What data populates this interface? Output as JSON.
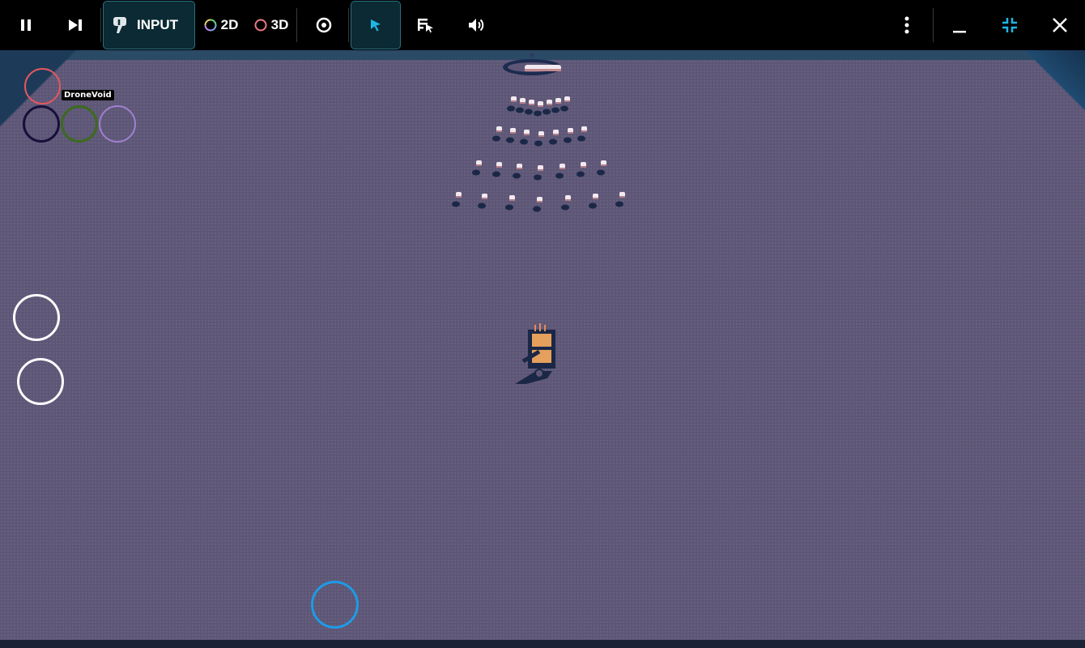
{
  "toolbar": {
    "pause": {
      "icon": "pause-icon"
    },
    "step": {
      "icon": "step-forward-icon"
    },
    "input": {
      "label": "INPUT",
      "icon": "input-hand-icon",
      "active": true
    },
    "mode_2d": {
      "label": "2D",
      "icon": "ring-multicolor-icon"
    },
    "mode_3d": {
      "label": "3D",
      "icon": "ring-pink-icon"
    },
    "view": {
      "icon": "eye-icon"
    },
    "select": {
      "icon": "cursor-arrow-icon",
      "active": true
    },
    "inspect": {
      "icon": "list-pointer-icon"
    },
    "sound": {
      "icon": "speaker-icon"
    },
    "more": {
      "icon": "more-vertical-icon"
    },
    "minimize": {
      "icon": "minimize-icon"
    },
    "fit": {
      "icon": "collapse-icon"
    },
    "close": {
      "icon": "close-icon"
    }
  },
  "hud": {
    "player_name": "DroneVoid",
    "player_colors": [
      "#e4575f",
      "#17103a",
      "#3d6a1e",
      "#a07fd0"
    ],
    "action_buttons": 2,
    "joystick_color": "#1d9be6"
  },
  "colors": {
    "accent": "#1fb6e6",
    "floor": "#5d5676"
  }
}
